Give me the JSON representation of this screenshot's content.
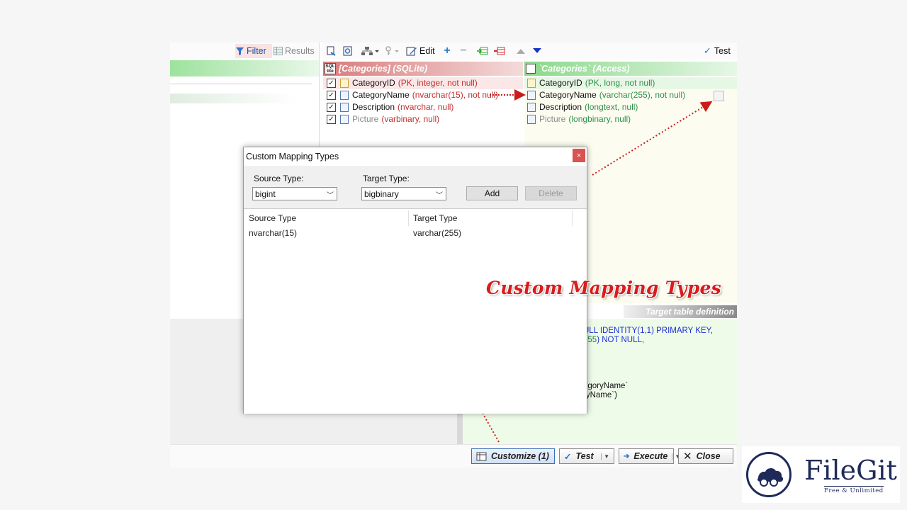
{
  "left_toolbar": {
    "filter_label": "Filter",
    "results_label": "Results"
  },
  "main_toolbar": {
    "edit_label": "Edit",
    "test_label": "Test"
  },
  "source_table": {
    "badge": "SQL\nlite",
    "title": "[Categories]  (SQLite)",
    "fields": [
      {
        "name": "CategoryID",
        "type": "(PK, integer, not null)",
        "checked": true,
        "pk": true,
        "dim": false
      },
      {
        "name": "CategoryName",
        "type": "(nvarchar(15), not null)",
        "checked": true,
        "pk": false,
        "dim": false
      },
      {
        "name": "Description",
        "type": "(nvarchar, null)",
        "checked": true,
        "pk": false,
        "dim": false
      },
      {
        "name": "Picture",
        "type": "(varbinary, null)",
        "checked": true,
        "pk": false,
        "dim": true
      }
    ]
  },
  "target_table": {
    "title": "`Categories`  (Access)",
    "fields": [
      {
        "name": "CategoryID",
        "type": "(PK, long, not null)",
        "pk": true,
        "dim": false
      },
      {
        "name": "CategoryName",
        "type": "(varchar(255), not null)",
        "pk": false,
        "dim": false
      },
      {
        "name": "Description",
        "type": "(longtext, null)",
        "pk": false,
        "dim": false
      },
      {
        "name": "Picture",
        "type": "(longbinary, null)",
        "pk": false,
        "dim": true
      }
    ]
  },
  "target_definition": {
    "title": "Target table definition",
    "lines": [
      {
        "kw": "ULL IDENTITY(1,1) PRIMARY KEY,",
        "num": "",
        "plain": ""
      },
      {
        "kw": ") NOT NULL,",
        "num": "255",
        "plain": ""
      },
      {
        "kw": "",
        "num": "",
        "plain": "egoryName`"
      },
      {
        "kw": "",
        "num": "",
        "plain": "ryName`)"
      }
    ]
  },
  "annotation": "Custom Mapping Types",
  "bottom_buttons": {
    "customize": "Customize (1)",
    "test": "Test",
    "execute": "Execute",
    "close": "Close"
  },
  "dialog": {
    "title": "Custom Mapping Types",
    "close_glyph": "×",
    "source_type_label": "Source Type:",
    "source_type_value": "bigint",
    "target_type_label": "Target Type:",
    "target_type_value": "bigbinary",
    "add_label": "Add",
    "delete_label": "Delete",
    "grid": {
      "columns": [
        "Source Type",
        "Target Type"
      ],
      "rows": [
        [
          "nvarchar(15)",
          "varchar(255)"
        ]
      ]
    }
  },
  "logo": {
    "name": "FileGit",
    "tagline": "Free & Unlimited"
  },
  "colors": {
    "source_accent": "#c0302e",
    "target_accent": "#2f8f4a",
    "annotation": "#d81d1d",
    "keyword": "#1c2ed8"
  }
}
